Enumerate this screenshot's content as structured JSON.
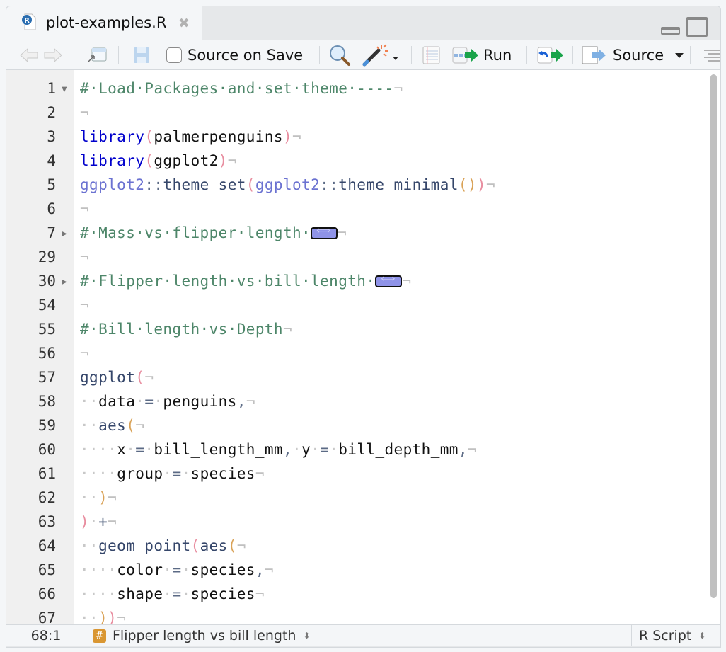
{
  "tab": {
    "filename": "plot-examples.R",
    "icon": "r-file-icon",
    "close_icon": "close-icon"
  },
  "toolbar": {
    "source_on_save_label": "Source on Save",
    "source_on_save_checked": false,
    "run_label": "Run",
    "source_label": "Source",
    "icons": [
      "back-arrow-icon",
      "forward-arrow-icon",
      "show-in-window-icon",
      "save-icon",
      "search-icon",
      "magic-wand-icon",
      "compile-notebook-icon",
      "run-icon",
      "rerun-icon",
      "source-icon",
      "outline-icon"
    ]
  },
  "editor": {
    "lines": [
      {
        "num": "1",
        "fold": "open",
        "tokens": [
          [
            "cm",
            "#·Load·Packages·and·set·theme·----"
          ],
          [
            "nl",
            "¬"
          ]
        ]
      },
      {
        "num": "2",
        "tokens": [
          [
            "nl",
            "¬"
          ]
        ]
      },
      {
        "num": "3",
        "tokens": [
          [
            "kw",
            "library"
          ],
          [
            "p1",
            "("
          ],
          [
            "",
            "palmerpenguins"
          ],
          [
            "p1",
            ")"
          ],
          [
            "nl",
            "¬"
          ]
        ]
      },
      {
        "num": "4",
        "tokens": [
          [
            "kw",
            "library"
          ],
          [
            "p1",
            "("
          ],
          [
            "",
            "ggplot2"
          ],
          [
            "p1",
            ")"
          ],
          [
            "nl",
            "¬"
          ]
        ]
      },
      {
        "num": "5",
        "tokens": [
          [
            "ns",
            "ggplot2"
          ],
          [
            "op",
            "::"
          ],
          [
            "fn",
            "theme_set"
          ],
          [
            "p1",
            "("
          ],
          [
            "ns",
            "ggplot2"
          ],
          [
            "op",
            "::"
          ],
          [
            "fn",
            "theme_minimal"
          ],
          [
            "p2",
            "()"
          ],
          [
            "p1",
            ")"
          ],
          [
            "nl",
            "¬"
          ]
        ]
      },
      {
        "num": "6",
        "tokens": [
          [
            "nl",
            "¬"
          ]
        ]
      },
      {
        "num": "7",
        "fold": "closed",
        "tokens": [
          [
            "cm",
            "#·Mass·vs·flipper·length·"
          ],
          [
            "widget",
            ""
          ],
          [
            "nl",
            "¬"
          ]
        ]
      },
      {
        "num": "29",
        "tokens": [
          [
            "nl",
            "¬"
          ]
        ]
      },
      {
        "num": "30",
        "fold": "closed",
        "tokens": [
          [
            "cm",
            "#·Flipper·length·vs·bill·length·"
          ],
          [
            "widget",
            ""
          ],
          [
            "nl",
            "¬"
          ]
        ]
      },
      {
        "num": "54",
        "tokens": [
          [
            "nl",
            "¬"
          ]
        ]
      },
      {
        "num": "55",
        "tokens": [
          [
            "cm",
            "#·Bill·length·vs·Depth"
          ],
          [
            "nl",
            "¬"
          ]
        ]
      },
      {
        "num": "56",
        "tokens": [
          [
            "nl",
            "¬"
          ]
        ]
      },
      {
        "num": "57",
        "tokens": [
          [
            "fn",
            "ggplot"
          ],
          [
            "p1",
            "("
          ],
          [
            "nl",
            "¬"
          ]
        ]
      },
      {
        "num": "58",
        "tokens": [
          [
            "ws",
            "··"
          ],
          [
            "",
            "data"
          ],
          [
            "ws",
            "·"
          ],
          [
            "op",
            "="
          ],
          [
            "ws",
            "·"
          ],
          [
            "",
            "penguins"
          ],
          [
            "op",
            ","
          ],
          [
            "nl",
            "¬"
          ]
        ]
      },
      {
        "num": "59",
        "tokens": [
          [
            "ws",
            "··"
          ],
          [
            "fn",
            "aes"
          ],
          [
            "p2",
            "("
          ],
          [
            "nl",
            "¬"
          ]
        ]
      },
      {
        "num": "60",
        "tokens": [
          [
            "ws",
            "····"
          ],
          [
            "",
            "x"
          ],
          [
            "ws",
            "·"
          ],
          [
            "op",
            "="
          ],
          [
            "ws",
            "·"
          ],
          [
            "",
            "bill_length_mm"
          ],
          [
            "op",
            ","
          ],
          [
            "ws",
            "·"
          ],
          [
            "",
            "y"
          ],
          [
            "ws",
            "·"
          ],
          [
            "op",
            "="
          ],
          [
            "ws",
            "·"
          ],
          [
            "",
            "bill_depth_mm"
          ],
          [
            "op",
            ","
          ],
          [
            "nl",
            "¬"
          ]
        ]
      },
      {
        "num": "61",
        "tokens": [
          [
            "ws",
            "····"
          ],
          [
            "",
            "group"
          ],
          [
            "ws",
            "·"
          ],
          [
            "op",
            "="
          ],
          [
            "ws",
            "·"
          ],
          [
            "",
            "species"
          ],
          [
            "nl",
            "¬"
          ]
        ]
      },
      {
        "num": "62",
        "tokens": [
          [
            "ws",
            "··"
          ],
          [
            "p2",
            ")"
          ],
          [
            "nl",
            "¬"
          ]
        ]
      },
      {
        "num": "63",
        "tokens": [
          [
            "p1",
            ")"
          ],
          [
            "ws",
            "·"
          ],
          [
            "op",
            "+"
          ],
          [
            "nl",
            "¬"
          ]
        ]
      },
      {
        "num": "64",
        "tokens": [
          [
            "ws",
            "··"
          ],
          [
            "fn",
            "geom_point"
          ],
          [
            "p1",
            "("
          ],
          [
            "fn",
            "aes"
          ],
          [
            "p2",
            "("
          ],
          [
            "nl",
            "¬"
          ]
        ]
      },
      {
        "num": "65",
        "tokens": [
          [
            "ws",
            "····"
          ],
          [
            "",
            "color"
          ],
          [
            "ws",
            "·"
          ],
          [
            "op",
            "="
          ],
          [
            "ws",
            "·"
          ],
          [
            "",
            "species"
          ],
          [
            "op",
            ","
          ],
          [
            "nl",
            "¬"
          ]
        ]
      },
      {
        "num": "66",
        "tokens": [
          [
            "ws",
            "····"
          ],
          [
            "",
            "shape"
          ],
          [
            "ws",
            "·"
          ],
          [
            "op",
            "="
          ],
          [
            "ws",
            "·"
          ],
          [
            "",
            "species"
          ],
          [
            "nl",
            "¬"
          ]
        ]
      },
      {
        "num": "67",
        "tokens": [
          [
            "ws",
            "··"
          ],
          [
            "p2",
            ")"
          ],
          [
            "p1",
            ")"
          ],
          [
            "nl",
            "¬"
          ]
        ]
      }
    ]
  },
  "statusbar": {
    "cursor_position": "68:1",
    "section_badge": "#",
    "section_label": "Flipper length vs bill length",
    "file_type": "R Script"
  }
}
